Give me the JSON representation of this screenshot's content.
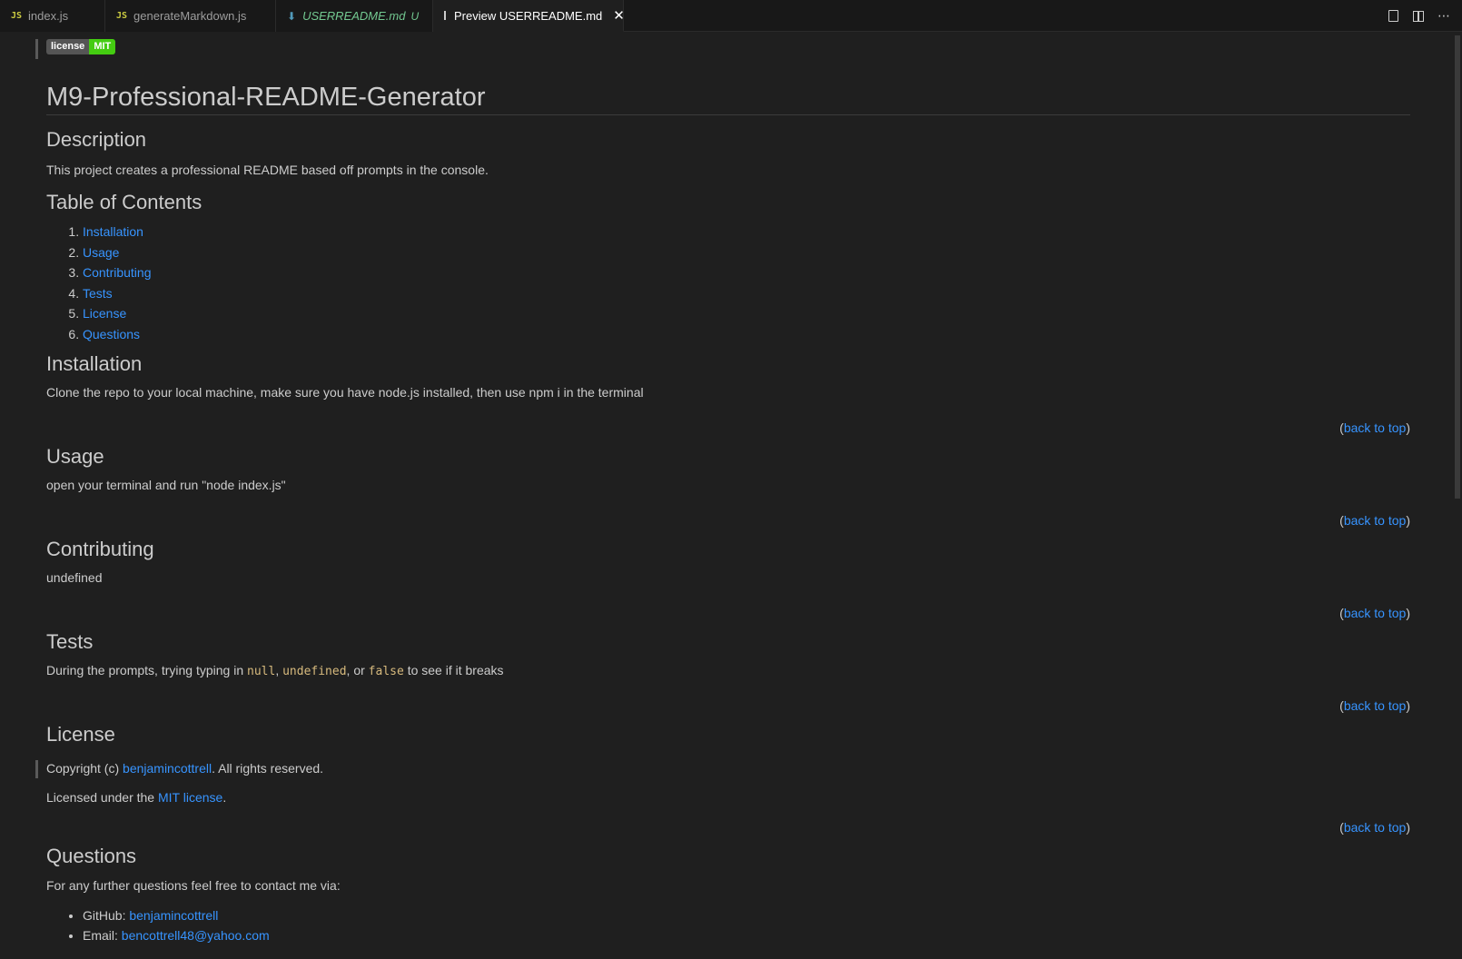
{
  "tabs": [
    {
      "label": "index.js",
      "icon": "JS"
    },
    {
      "label": "generateMarkdown.js",
      "icon": "JS"
    },
    {
      "label": "USERREADME.md",
      "status": "U"
    },
    {
      "label": "Preview USERREADME.md"
    }
  ],
  "badge": {
    "left": "license",
    "right": "MIT"
  },
  "title": "M9-Professional-README-Generator",
  "description": {
    "heading": "Description",
    "text": "This project creates a professional README based off prompts in the console."
  },
  "toc": {
    "heading": "Table of Contents",
    "items": [
      "Installation",
      "Usage",
      "Contributing",
      "Tests",
      "License",
      "Questions"
    ]
  },
  "installation": {
    "heading": "Installation",
    "text": "Clone the repo to your local machine, make sure you have node.js installed, then use npm i in the terminal"
  },
  "usage": {
    "heading": "Usage",
    "text": "open your terminal and run \"node index.js\""
  },
  "contributing": {
    "heading": "Contributing",
    "text": "undefined"
  },
  "tests": {
    "heading": "Tests",
    "prefix": "During the prompts, trying typing in ",
    "code1": "null",
    "sep1": ", ",
    "code2": "undefined",
    "sep2": ", or ",
    "code3": "false",
    "suffix": " to see if it breaks"
  },
  "license": {
    "heading": "License",
    "copyright_prefix": "Copyright (c) ",
    "copyright_link": "benjamincottrell",
    "copyright_suffix": ". All rights reserved.",
    "licensed_prefix": "Licensed under the ",
    "licensed_link": "MIT license",
    "licensed_suffix": "."
  },
  "questions": {
    "heading": "Questions",
    "text": "For any further questions feel free to contact me via:",
    "github_label": "GitHub: ",
    "github_value": "benjamincottrell",
    "email_label": "Email: ",
    "email_value": "bencottrell48@yahoo.com"
  },
  "back_to_top": {
    "open": "(",
    "link": "back to top",
    "close": ")"
  },
  "colors": {
    "link": "#3794ff",
    "code": "#d7ba7d",
    "badge_green": "#44cc11"
  }
}
